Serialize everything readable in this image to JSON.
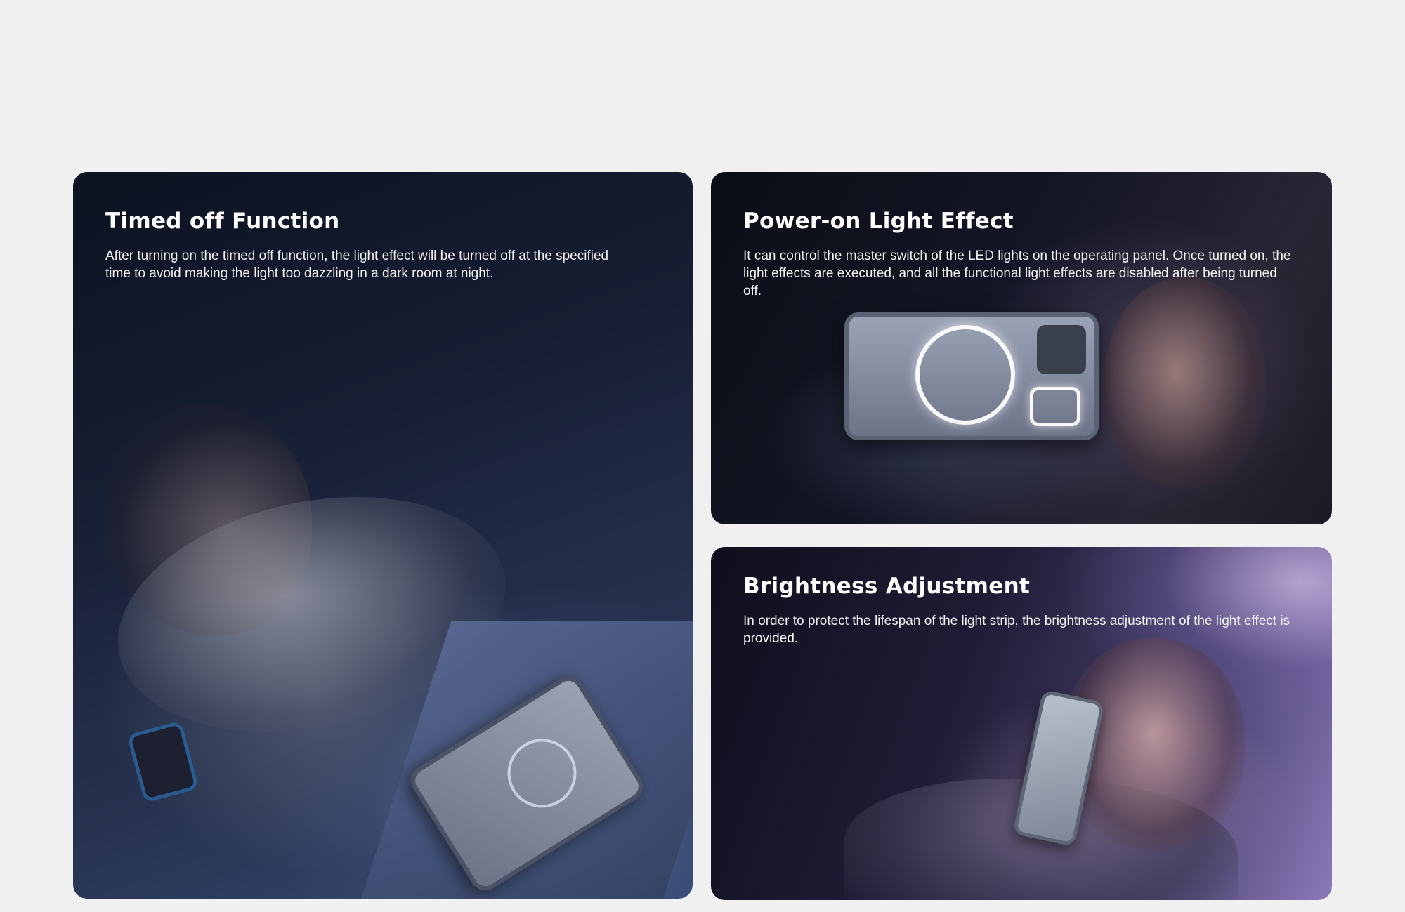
{
  "cards": [
    {
      "title": "Timed off Function",
      "description": "After turning on the timed off function, the light effect will be turned off at the specified time to avoid making the light too dazzling in a dark room at night."
    },
    {
      "title": "Power-on Light Effect",
      "description": "It can control the master switch of the LED lights on the operating panel.  Once turned on, the light effects are executed, and all the functional light effects are disabled after being turned off."
    },
    {
      "title": "Brightness Adjustment",
      "description": "In order to protect the lifespan of the light strip, the brightness adjustment of the light effect is provided."
    }
  ]
}
